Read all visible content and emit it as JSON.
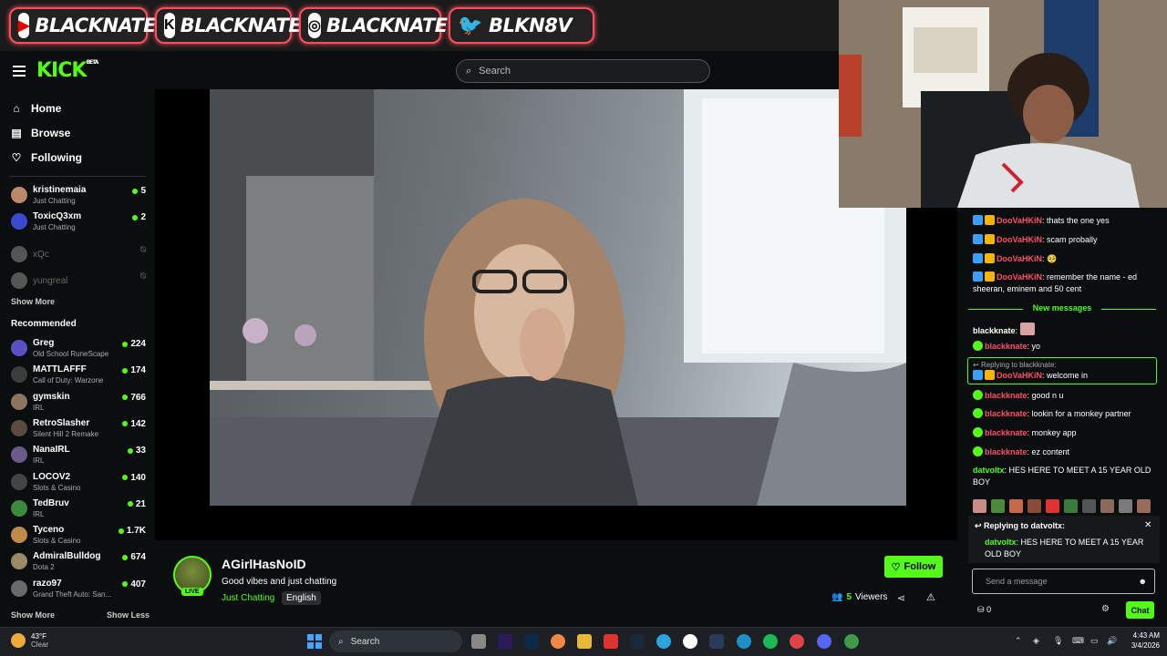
{
  "banner": {
    "items": [
      {
        "icon": "youtube-icon",
        "text": "BLACKNATE"
      },
      {
        "icon": "kick-icon",
        "text": "BLACKNATE"
      },
      {
        "icon": "instagram-icon",
        "text": "BLACKNATEYT"
      },
      {
        "icon": "twitter-icon",
        "text": "BLKN8V"
      }
    ]
  },
  "header": {
    "logo": "KICK",
    "logo_sup": "BETA",
    "search_placeholder": "Search"
  },
  "sidebar": {
    "nav": [
      {
        "label": "Home",
        "icon": "home-icon"
      },
      {
        "label": "Browse",
        "icon": "browse-icon"
      },
      {
        "label": "Following",
        "icon": "heart-icon"
      }
    ],
    "following": [
      {
        "name": "kristinemaia",
        "category": "Just Chatting",
        "viewers": "5",
        "live": true,
        "color": "#b88a6a"
      },
      {
        "name": "ToxicQ3xm",
        "category": "Just Chatting",
        "viewers": "2",
        "live": true,
        "color": "#3a4bd0"
      },
      {
        "name": "xQc",
        "category": "",
        "viewers": "",
        "live": false,
        "color": "#555"
      },
      {
        "name": "yungreal",
        "category": "",
        "viewers": "",
        "live": false,
        "color": "#555"
      }
    ],
    "show_more": "Show More",
    "recommended_title": "Recommended",
    "recommended": [
      {
        "name": "Greg",
        "category": "Old School RuneScape",
        "viewers": "224",
        "color": "#5a52c2"
      },
      {
        "name": "MATTLAFFF",
        "category": "Call of Duty: Warzone",
        "viewers": "174",
        "color": "#3c3c3c"
      },
      {
        "name": "gymskin",
        "category": "IRL",
        "viewers": "766",
        "color": "#8b7561"
      },
      {
        "name": "RetroSlasher",
        "category": "Silent Hill 2 Remake",
        "viewers": "142",
        "color": "#5a4a40"
      },
      {
        "name": "NanaIRL",
        "category": "IRL",
        "viewers": "33",
        "color": "#6a5a8a"
      },
      {
        "name": "LOCOV2",
        "category": "Slots & Casino",
        "viewers": "140",
        "color": "#444"
      },
      {
        "name": "TedBruv",
        "category": "IRL",
        "viewers": "21",
        "color": "#3c8a3c"
      },
      {
        "name": "Tyceno",
        "category": "Slots & Casino",
        "viewers": "1.7K",
        "color": "#c28a4a"
      },
      {
        "name": "AdmiralBulldog",
        "category": "Dota 2",
        "viewers": "674",
        "color": "#9a8a6a"
      },
      {
        "name": "razo97",
        "category": "Grand Theft Auto: San...",
        "viewers": "407",
        "color": "#6a6a6a"
      }
    ],
    "show_more_2": "Show More",
    "show_less": "Show Less"
  },
  "stream": {
    "name": "AGirlHasNoID",
    "title": "Good vibes and just chatting",
    "category": "Just Chatting",
    "language": "English",
    "live_label": "LIVE",
    "follow_label": "Follow",
    "viewers_count": "5",
    "viewers_label": "Viewers"
  },
  "chat": {
    "messages": [
      {
        "user": "DooVaHKiN",
        "text": ": thats the one yes",
        "badges": [
          "blue",
          "gold"
        ],
        "user_color": "red"
      },
      {
        "user": "DooVaHKiN",
        "text": ": scam probally",
        "badges": [
          "blue",
          "gold"
        ],
        "user_color": "red"
      },
      {
        "user": "DooVaHKiN",
        "text": ": 🥺",
        "badges": [
          "blue",
          "gold"
        ],
        "user_color": "red"
      },
      {
        "user": "DooVaHKiN",
        "text": ": remember the name - ed sheeran, eminem and 50 cent",
        "badges": [
          "blue",
          "gold"
        ],
        "user_color": "red"
      }
    ],
    "new_messages_label": "New messages",
    "new_messages": [
      {
        "user": "blackknate",
        "text": ":",
        "badges": [],
        "user_color": "white",
        "emote": true
      },
      {
        "user": "blackknate",
        "text": ": yo",
        "badges": [
          "green"
        ],
        "user_color": "red"
      },
      {
        "user": "blackknate",
        "text": ": good n u",
        "badges": [
          "green"
        ],
        "user_color": "red"
      },
      {
        "user": "blackknate",
        "text": ": lookin for a monkey partner",
        "badges": [
          "green"
        ],
        "user_color": "red"
      },
      {
        "user": "blackknate",
        "text": ": monkey app",
        "badges": [
          "green"
        ],
        "user_color": "red"
      },
      {
        "user": "blackknate",
        "text": ": ez content",
        "badges": [
          "green"
        ],
        "user_color": "red"
      },
      {
        "user": "datvoltx",
        "text": ": HES HERE TO MEET A 15 YEAR OLD BOY",
        "badges": [],
        "user_color": "green"
      }
    ],
    "reply_highlight": {
      "reply_to": "Replying to blackknate:",
      "user": "DooVaHKiN",
      "text": ": welcome in"
    },
    "reply_panel": {
      "title": "Replying to datvoltx:",
      "quote_user": "datvoltx",
      "quote_text": ": HES HERE TO MEET A 15 YEAR OLD BOY"
    },
    "input_placeholder": "Send a message",
    "points": "0",
    "send_label": "Chat"
  },
  "taskbar": {
    "weather_temp": "43°F",
    "weather_desc": "Clear",
    "search_label": "Search",
    "time": "4:43 AM",
    "date": "3/4/2026"
  }
}
